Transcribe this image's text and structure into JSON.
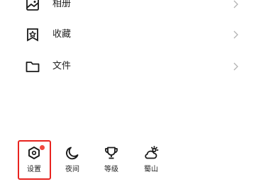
{
  "menu": {
    "items": [
      {
        "label": "相册",
        "icon": "album-icon"
      },
      {
        "label": "收藏",
        "icon": "favorites-star-icon"
      },
      {
        "label": "文件",
        "icon": "folder-icon"
      }
    ]
  },
  "bottom_bar": {
    "buttons": [
      {
        "label": "设置",
        "icon": "settings-hexagon-icon",
        "has_badge": true,
        "highlighted": true
      },
      {
        "label": "夜间",
        "icon": "moon-icon"
      },
      {
        "label": "等级",
        "icon": "trophy-icon"
      },
      {
        "label": "蜀山",
        "icon": "weather-cloud-sun-icon"
      }
    ]
  },
  "colors": {
    "badge": "#f0493f",
    "highlight": "#e8231f",
    "icon": "#1a1a1a",
    "chevron": "#b3b3b3"
  }
}
